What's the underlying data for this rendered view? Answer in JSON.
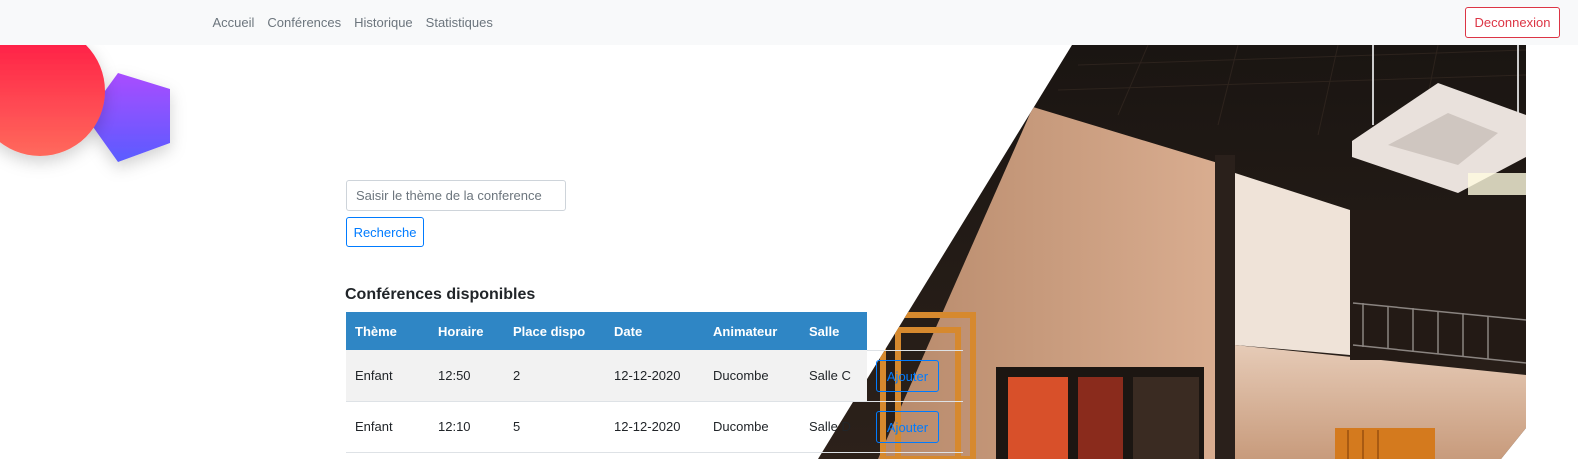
{
  "navbar": {
    "links": [
      "Accueil",
      "Conférences",
      "Historique",
      "Statistiques"
    ],
    "logout_label": "Deconnexion"
  },
  "search": {
    "placeholder": "Saisir le thème de la conference",
    "value": "",
    "button_label": "Recherche"
  },
  "section_title": "Conférences disponibles",
  "table": {
    "headers": [
      "Thème",
      "Horaire",
      "Place dispo",
      "Date",
      "Animateur",
      "Salle"
    ],
    "rows": [
      {
        "theme": "Enfant",
        "horaire": "12:50",
        "place": "2",
        "date": "12-12-2020",
        "animateur": "Ducombe",
        "salle": "Salle C",
        "action": "Ajouter"
      },
      {
        "theme": "Enfant",
        "horaire": "12:10",
        "place": "5",
        "date": "12-12-2020",
        "animateur": "Ducombe",
        "salle": "Salle D",
        "action": "Ajouter"
      }
    ]
  },
  "colors": {
    "navbar_bg": "#f8f9fa",
    "table_header": "#2f86c5",
    "primary": "#007bff",
    "danger": "#dc3545",
    "deco_circle": "#ff2d55",
    "deco_pentagon": "#7b4dff"
  },
  "icons": [
    "decorative-circle",
    "decorative-pentagon",
    "building-interior-photo"
  ]
}
